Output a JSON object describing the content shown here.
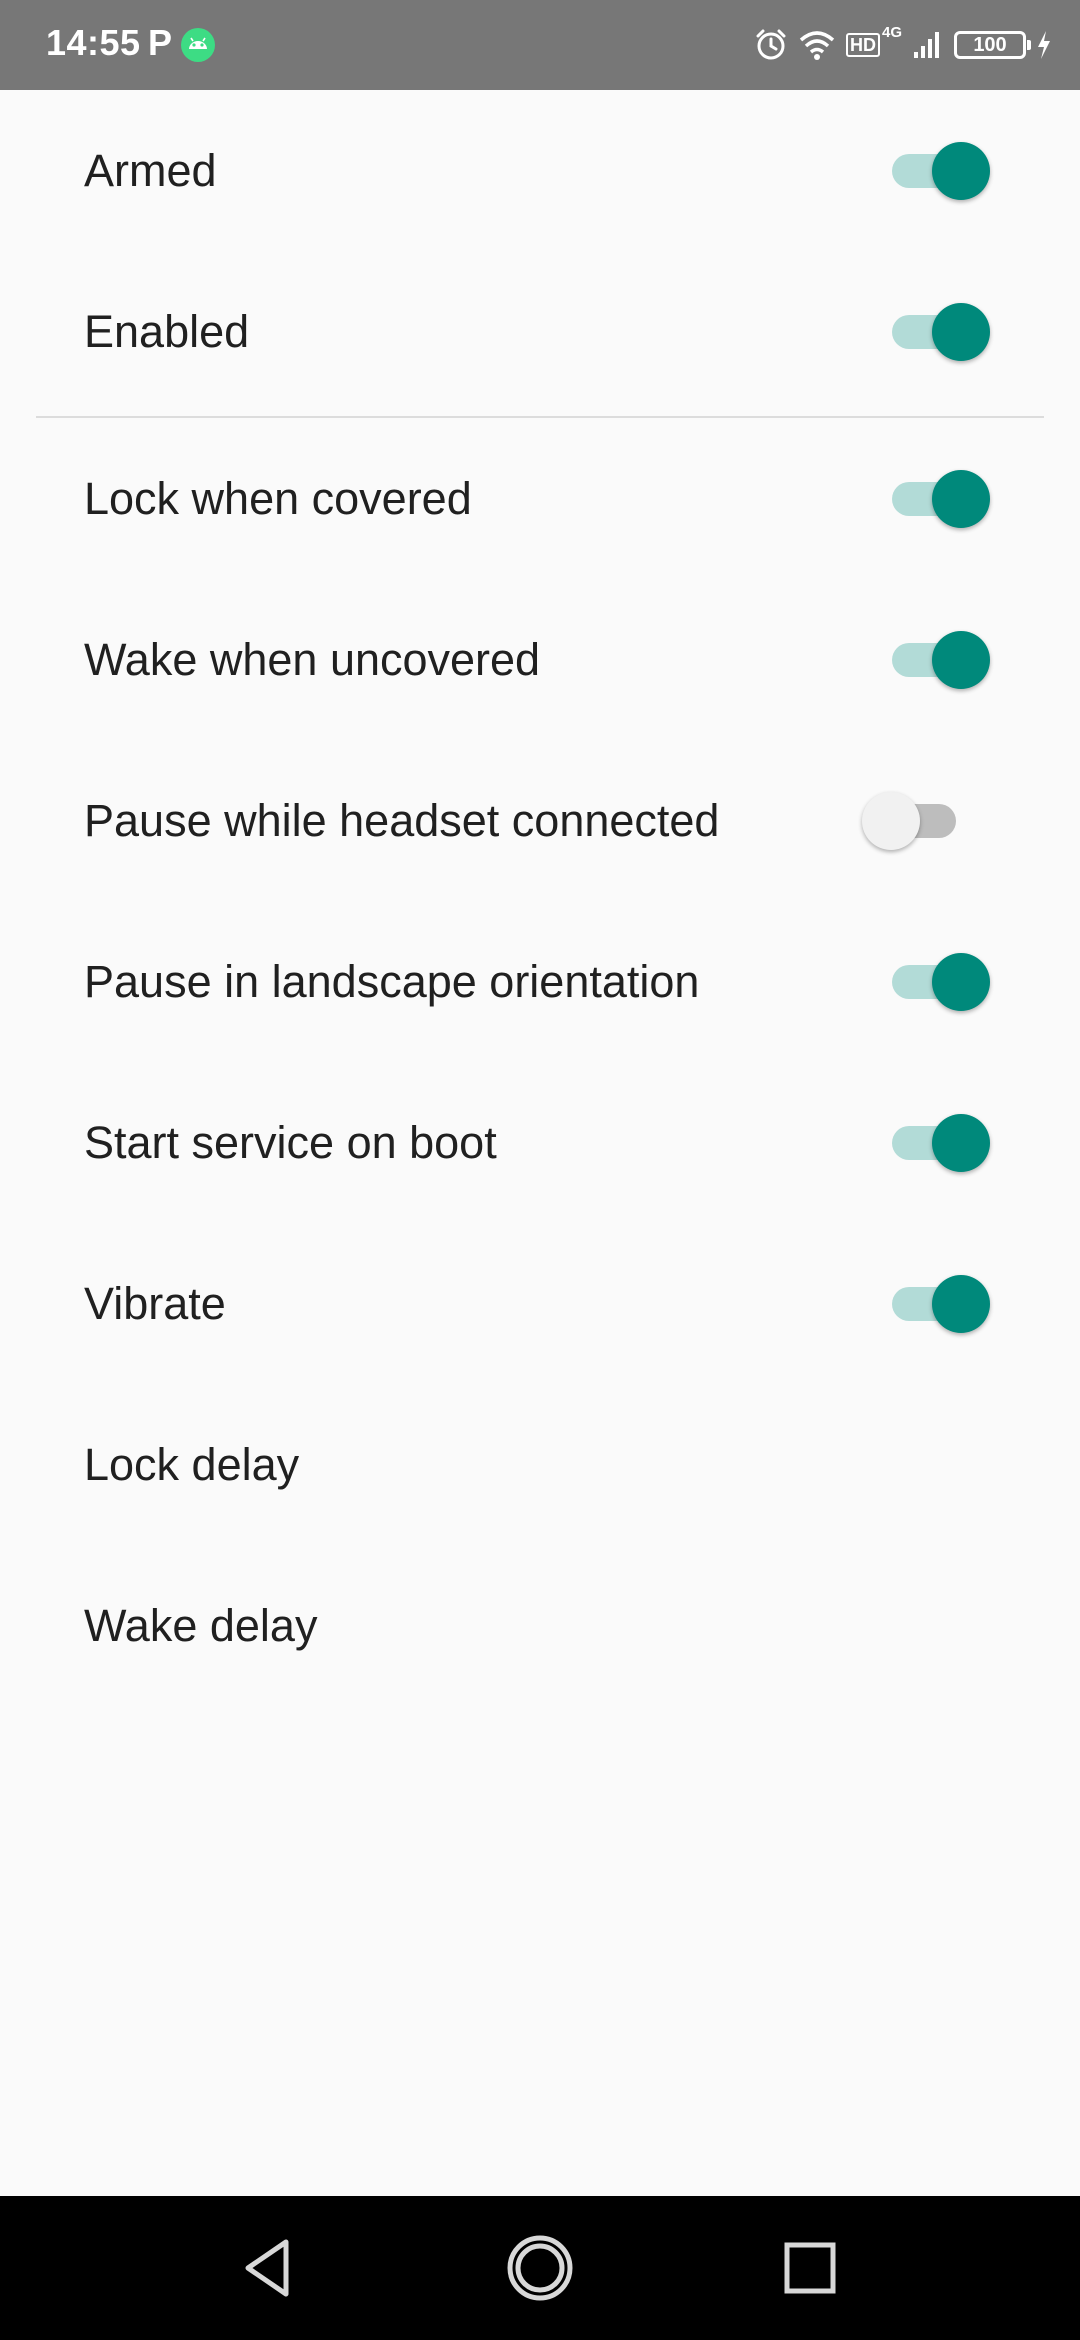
{
  "status_bar": {
    "time": "14:55",
    "notification_letter": "P",
    "battery_level": "100",
    "network_label": "4G",
    "hd_label": "HD",
    "icons": [
      "android-icon",
      "alarm-icon",
      "wifi-icon",
      "signal-icon",
      "battery-icon",
      "charging-icon"
    ]
  },
  "settings": {
    "items": [
      {
        "label": "Armed",
        "switch_on": true
      },
      {
        "label": "Enabled",
        "switch_on": true
      },
      {
        "label": "Lock when covered",
        "switch_on": true
      },
      {
        "label": "Wake when uncovered",
        "switch_on": true
      },
      {
        "label": "Pause while headset connected",
        "switch_on": false
      },
      {
        "label": "Pause in landscape orientation",
        "switch_on": true
      },
      {
        "label": "Start service on boot",
        "switch_on": true
      },
      {
        "label": "Vibrate",
        "switch_on": true
      },
      {
        "label": "Lock delay"
      },
      {
        "label": "Wake delay"
      }
    ]
  },
  "nav_bar": {
    "icons": [
      "back-icon",
      "home-icon",
      "recents-icon"
    ]
  },
  "colors": {
    "accent": "#00897b",
    "accent_track": "#b2dbd7",
    "status_bar": "#777777",
    "background": "#fafafa"
  }
}
